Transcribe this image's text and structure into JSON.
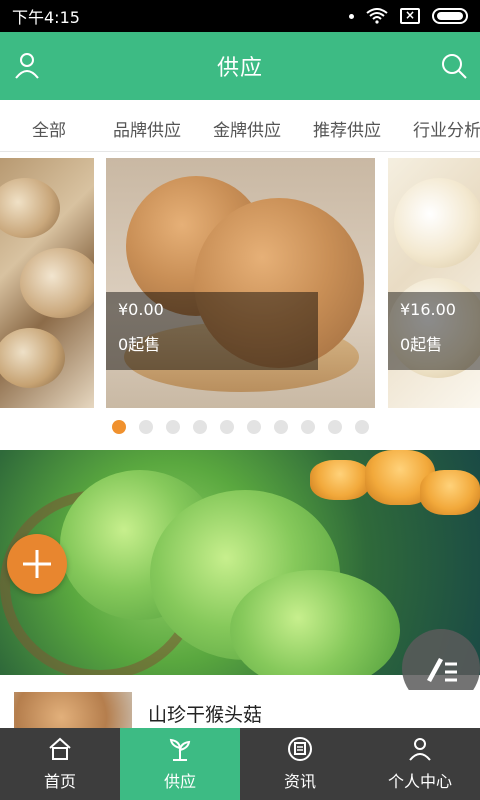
{
  "status_bar": {
    "time": "下午4:15"
  },
  "app_bar": {
    "title": "供应",
    "left_icon": "user-icon",
    "right_icon": "search-icon"
  },
  "tabs": [
    "全部",
    "品牌供应",
    "金牌供应",
    "推荐供应",
    "行业分析"
  ],
  "carousel": {
    "cards": [
      {
        "price": "",
        "moq": ""
      },
      {
        "price": "¥0.00",
        "moq": "0起售"
      },
      {
        "price": "¥16.00",
        "moq": "0起售"
      }
    ],
    "page_count": 10,
    "active_index": 0
  },
  "fab": {
    "add_icon": "plus-icon",
    "edit_icon": "edit-list-icon"
  },
  "list": [
    {
      "title": "山珍干猴头菇"
    }
  ],
  "bottom_nav": [
    {
      "label": "首页",
      "icon": "home-icon"
    },
    {
      "label": "供应",
      "icon": "leaf-icon"
    },
    {
      "label": "资讯",
      "icon": "news-icon"
    },
    {
      "label": "个人中心",
      "icon": "profile-icon"
    }
  ],
  "colors": {
    "primary": "#3dbb84",
    "accent": "#f0912e",
    "nav_bg": "#3d3d3d"
  }
}
